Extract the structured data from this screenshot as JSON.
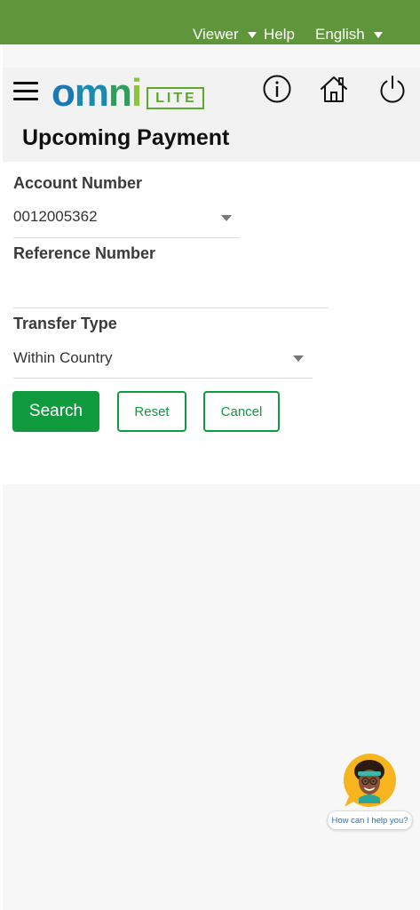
{
  "topbar": {
    "role_label": "Viewer",
    "help_label": "Help",
    "language_label": "English",
    "bg_color": "#5f963b"
  },
  "header": {
    "logo_text": "omni",
    "logo_badge": "LITE",
    "icons": [
      "menu-icon",
      "info-icon",
      "home-icon",
      "power-icon"
    ]
  },
  "page": {
    "title": "Upcoming Payment"
  },
  "form": {
    "account_number_label": "Account Number",
    "account_number_value": "0012005362",
    "reference_number_label": "Reference Number",
    "reference_number_value": "",
    "transfer_type_label": "Transfer Type",
    "transfer_type_value": "Within Country"
  },
  "buttons": {
    "search_label": "Search",
    "reset_label": "Reset",
    "cancel_label": "Cancel",
    "accent_color": "#109a3e"
  },
  "chat": {
    "prompt": "How can I help you?"
  }
}
